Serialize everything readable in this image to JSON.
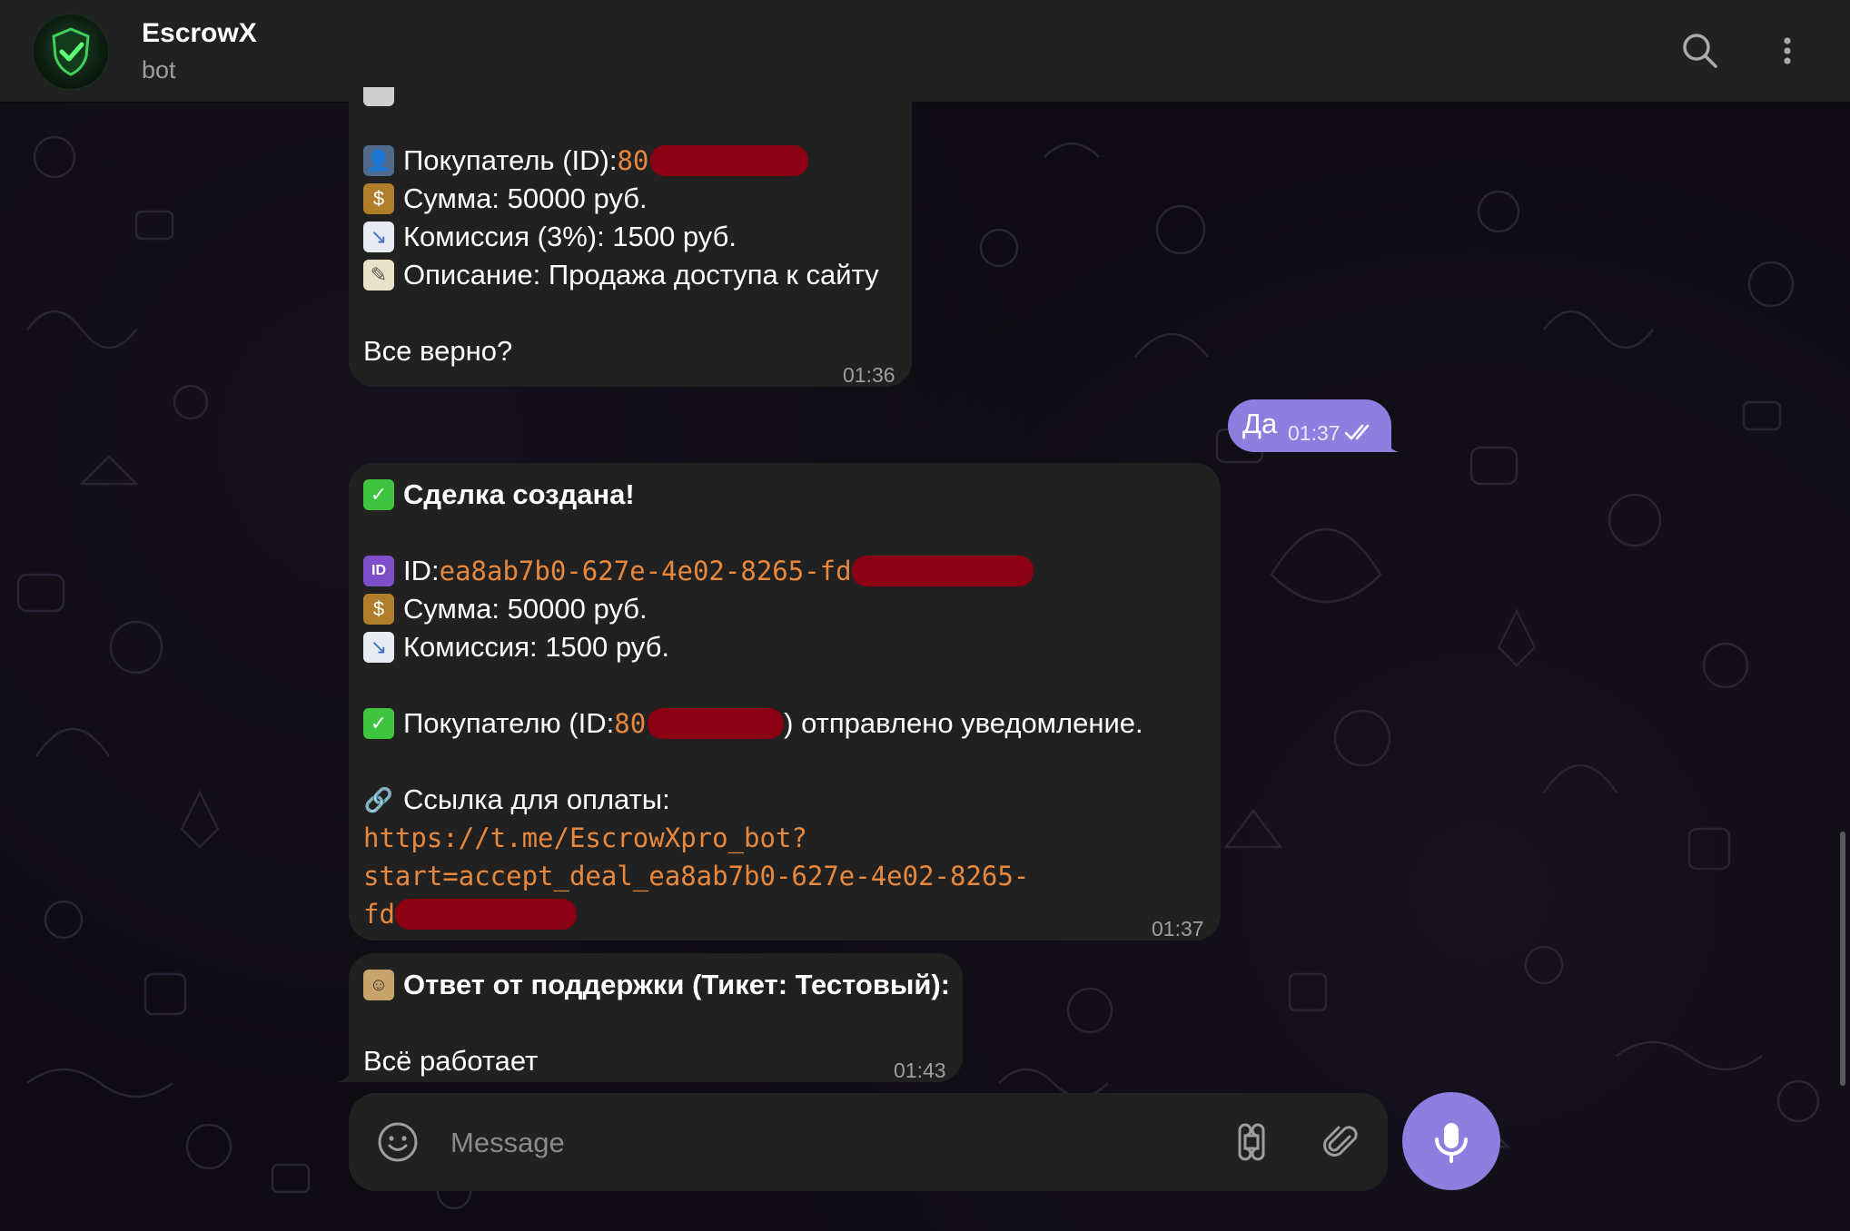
{
  "header": {
    "title": "EscrowX",
    "subtitle": "bot"
  },
  "messages": {
    "confirm": {
      "buyer_label": "Покупатель (ID): ",
      "buyer_id_visible": "80",
      "sum": "Сумма: 50000 руб.",
      "commission": "Комиссия (3%): 1500 руб.",
      "description": "Описание: Продажа доступа к сайту",
      "question": "Все верно?",
      "time": "01:36"
    },
    "outgoing": {
      "text": "Да",
      "time": "01:37"
    },
    "deal": {
      "title": "Сделка создана!",
      "id_label": "ID: ",
      "id_value": "ea8ab7b0-627e-4e02-8265-fd",
      "sum": "Сумма: 50000 руб.",
      "commission": "Комиссия: 1500 руб.",
      "notify_prefix": "Покупателю (ID: ",
      "notify_id_visible": "80",
      "notify_suffix": ") отправлено уведомление.",
      "link_label": "Ссылка для оплаты:",
      "link_line1": "https://t.me/EscrowXpro_bot?",
      "link_line2": "start=accept_deal_ea8ab7b0-627e-4e02-8265-",
      "link_line3": "fd",
      "time": "01:37"
    },
    "support": {
      "title": "Ответ от поддержки (Тикет: Тестовый):",
      "text": "Всё работает",
      "time": "01:43"
    }
  },
  "composer": {
    "placeholder": "Message"
  },
  "colors": {
    "accent": "#8d7ee0",
    "bubble": "#212121",
    "code": "#e8883c",
    "redaction": "#8b0012"
  }
}
